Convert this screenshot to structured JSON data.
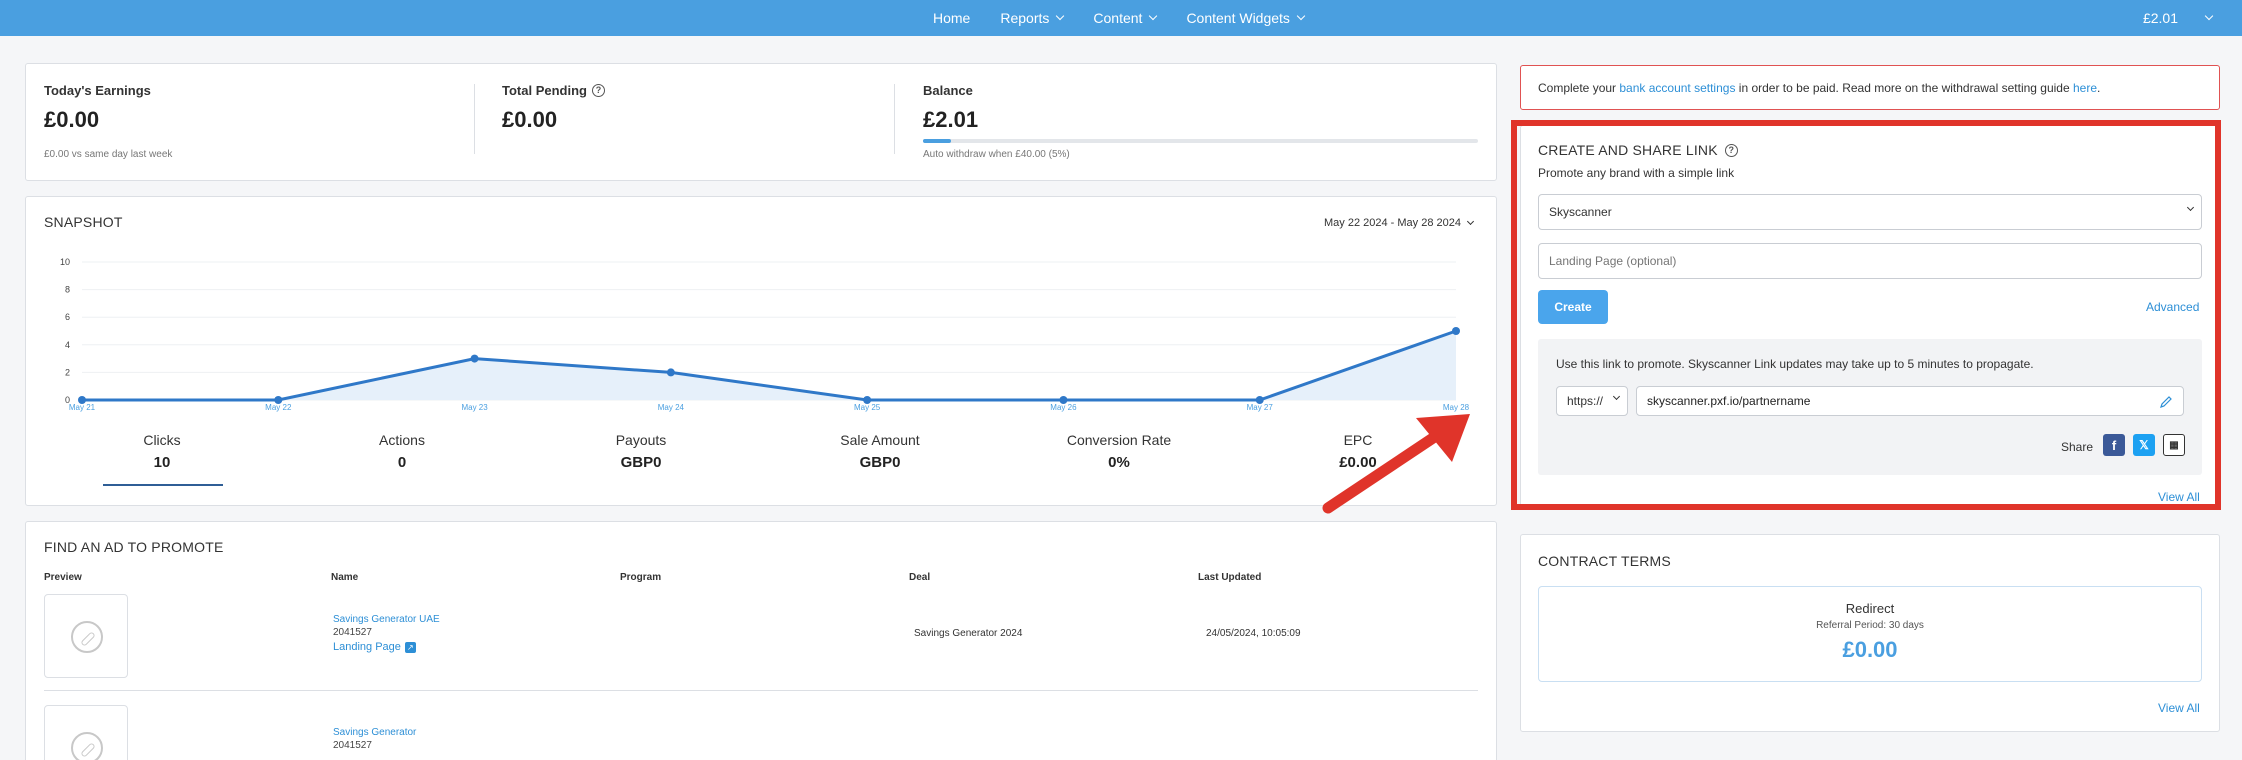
{
  "nav": {
    "items": [
      {
        "label": "Home",
        "dropdown": false
      },
      {
        "label": "Reports",
        "dropdown": true
      },
      {
        "label": "Content",
        "dropdown": true
      },
      {
        "label": "Content Widgets",
        "dropdown": true
      }
    ],
    "balance": "£2.01"
  },
  "stats": {
    "today": {
      "label": "Today's Earnings",
      "value": "£0.00",
      "sub": "£0.00 vs same day last week"
    },
    "pending": {
      "label": "Total Pending",
      "value": "£0.00"
    },
    "balance": {
      "label": "Balance",
      "value": "£2.01",
      "sub": "Auto withdraw when £40.00 (5%)",
      "progress_percent": 5
    }
  },
  "snapshot": {
    "title": "SNAPSHOT",
    "date_range": "May 22 2024 - May 28 2024",
    "metrics": [
      {
        "label": "Clicks",
        "value": "10"
      },
      {
        "label": "Actions",
        "value": "0"
      },
      {
        "label": "Payouts",
        "value": "GBP0"
      },
      {
        "label": "Sale Amount",
        "value": "GBP0"
      },
      {
        "label": "Conversion Rate",
        "value": "0%"
      },
      {
        "label": "EPC",
        "value": "£0.00"
      }
    ]
  },
  "chart_data": {
    "type": "area",
    "categories": [
      "May 21",
      "May 22",
      "May 23",
      "May 24",
      "May 25",
      "May 26",
      "May 27",
      "May 28"
    ],
    "values": [
      0,
      0,
      3,
      2,
      0,
      0,
      0,
      5
    ],
    "yticks": [
      0,
      2,
      4,
      6,
      8,
      10
    ],
    "ylim": [
      0,
      10
    ],
    "title": "",
    "xlabel": "",
    "ylabel": "",
    "line_color": "#2f78c8",
    "fill_color": "#e6f0fa"
  },
  "ads": {
    "title": "FIND AN AD TO PROMOTE",
    "columns": [
      "Preview",
      "Name",
      "Program",
      "Deal",
      "Last Updated"
    ],
    "rows": [
      {
        "name": "Savings Generator UAE",
        "id": "2041527",
        "landing": "Landing Page",
        "program": "",
        "deal": "Savings Generator 2024",
        "updated": "24/05/2024, 10:05:09"
      },
      {
        "name": "Savings Generator",
        "id": "2041527",
        "landing": "",
        "program": "",
        "deal": "",
        "updated": ""
      }
    ]
  },
  "notice": {
    "text1": "Complete your ",
    "link1": "bank account settings",
    "text2": " in order to be paid. Read more on the withdrawal setting guide ",
    "link2": "here",
    "text3": "."
  },
  "share": {
    "title": "CREATE AND SHARE LINK",
    "subtitle": "Promote any brand with a simple link",
    "brand_value": "Skyscanner",
    "landing_placeholder": "Landing Page (optional)",
    "create_label": "Create",
    "advanced_label": "Advanced",
    "info": "Use this link to promote. Skyscanner Link updates may take up to 5 minutes to propagate.",
    "protocol": "https://",
    "url": "skyscanner.pxf.io/partnername",
    "share_label": "Share",
    "view_all": "View All"
  },
  "contract": {
    "title": "CONTRACT TERMS",
    "type": "Redirect",
    "period": "Referral Period: 30 days",
    "amount": "£0.00",
    "view_all": "View All"
  },
  "colors": {
    "accent": "#4a9fe0",
    "highlight": "#e0342a",
    "link": "#2d8fd6"
  }
}
